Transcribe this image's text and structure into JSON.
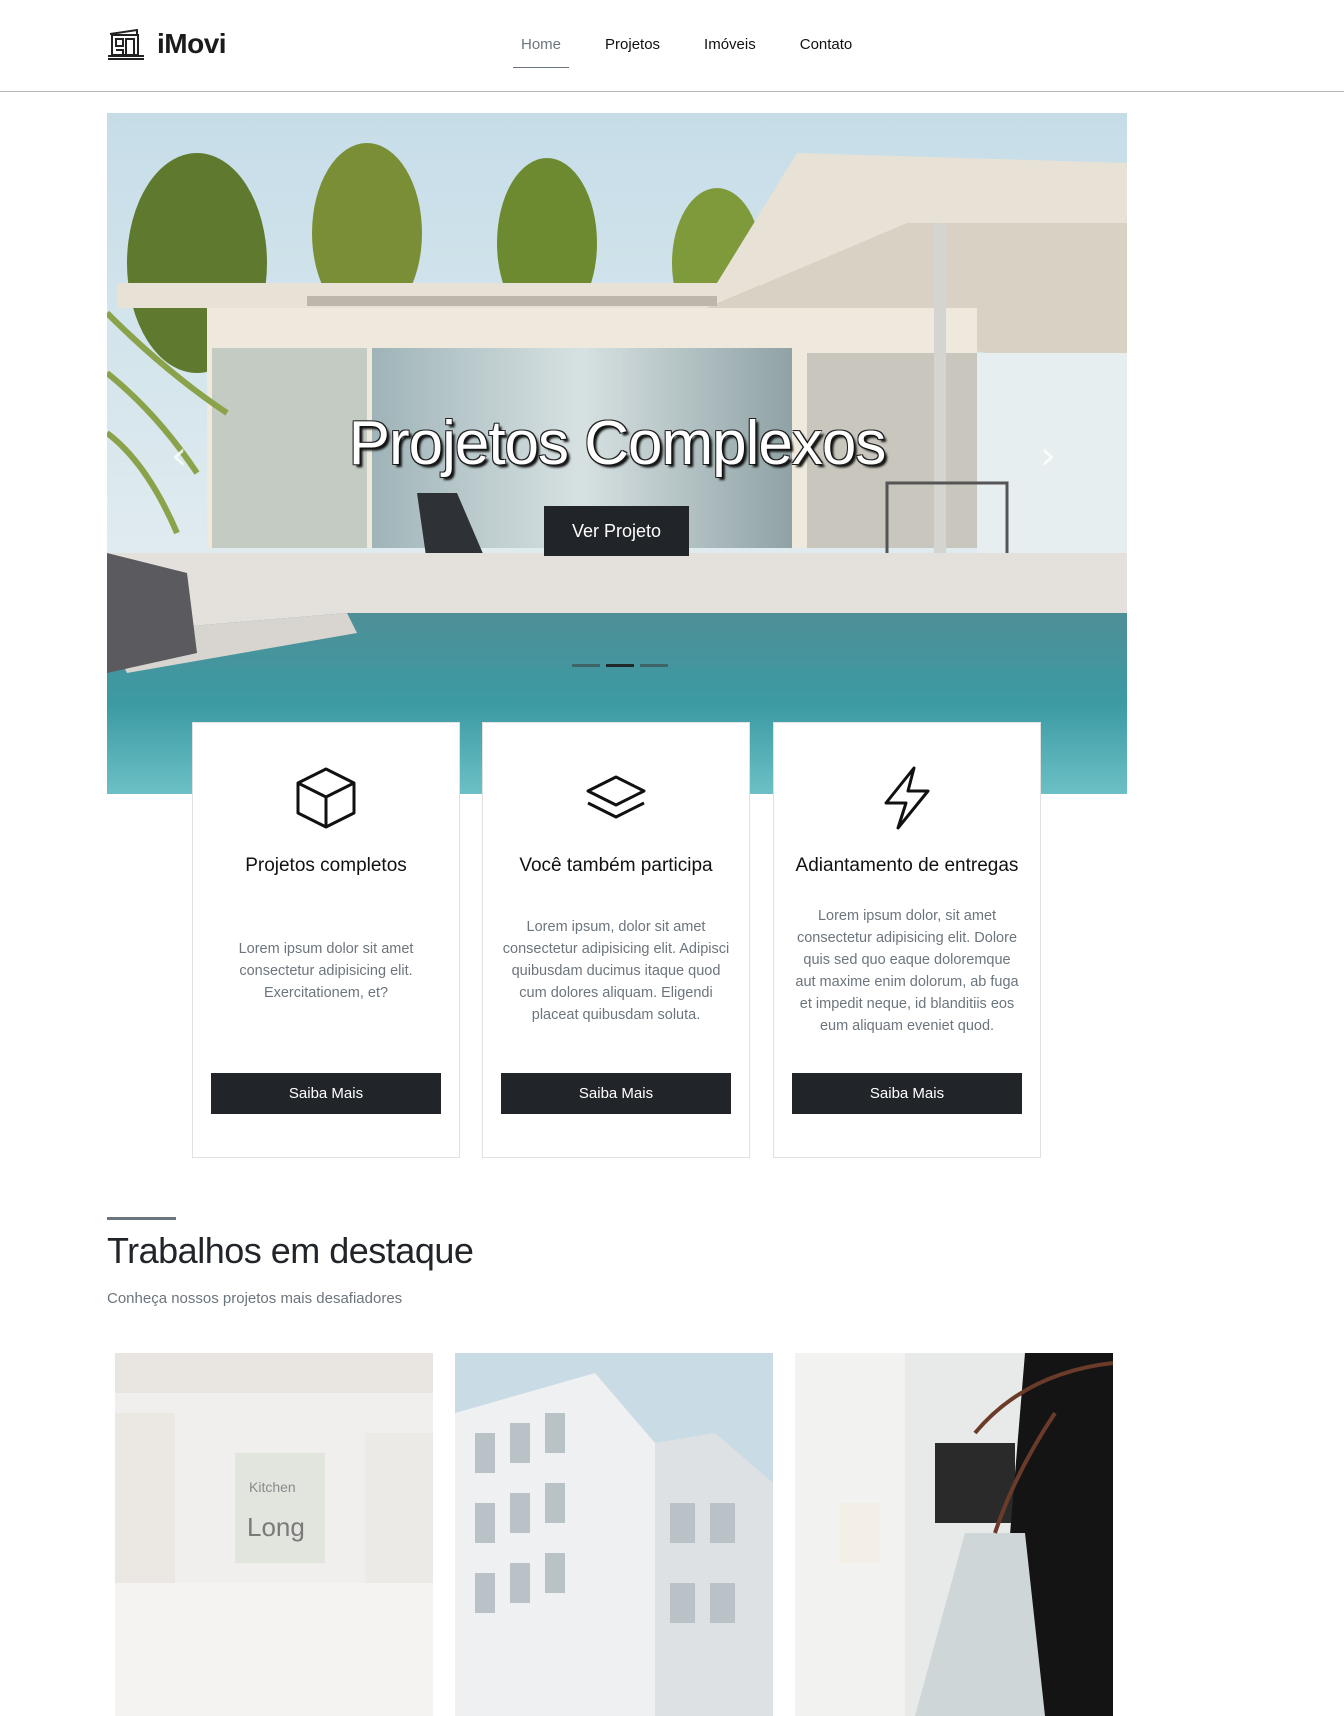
{
  "brand": {
    "name": "iMovi",
    "logo_icon": "building-icon"
  },
  "nav": {
    "items": [
      {
        "label": "Home",
        "active": true
      },
      {
        "label": "Projetos",
        "active": false
      },
      {
        "label": "Imóveis",
        "active": false
      },
      {
        "label": "Contato",
        "active": false
      }
    ]
  },
  "hero": {
    "title": "Projetos Complexos",
    "button_label": "Ver Projeto",
    "prev_arrow": "‹",
    "next_arrow": "›",
    "indicators": 3,
    "active_indicator": 1
  },
  "features": [
    {
      "icon": "box-icon",
      "title": "Projetos completos",
      "text": "Lorem ipsum dolor sit amet consectetur adipisicing elit. Exercitationem, et?",
      "button_label": "Saiba Mais"
    },
    {
      "icon": "layers-icon",
      "title": "Você também participa",
      "text": "Lorem ipsum, dolor sit amet consectetur adipisicing elit. Adipisci quibusdam ducimus itaque quod cum dolores aliquam. Eligendi placeat quibusdam soluta.",
      "button_label": "Saiba Mais"
    },
    {
      "icon": "lightning-icon",
      "title": "Adiantamento de entregas",
      "text": "Lorem ipsum dolor, sit amet consectetur adipisicing elit. Dolore quis sed quo eaque doloremque aut maxime enim dolorum, ab fuga et impedit neque, id blanditiis eos eum aliquam eveniet quod.",
      "button_label": "Saiba Mais"
    }
  ],
  "featured": {
    "title": "Trabalhos em destaque",
    "subtitle": "Conheça nossos projetos mais desafiadores",
    "items": [
      {
        "category": "Kitchen",
        "name": "Long"
      },
      {},
      {}
    ]
  },
  "colors": {
    "dark": "#212529",
    "muted": "#6c757d",
    "border": "#e1e1e1"
  }
}
